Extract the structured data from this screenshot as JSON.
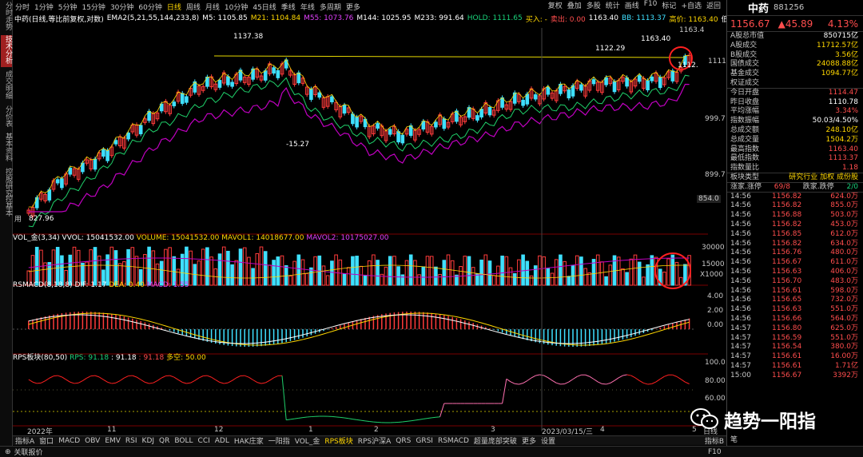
{
  "left_tabs": [
    "分时走势",
    "技术分析",
    "成交明细",
    "分价表",
    "基本资料",
    "控股研究",
    "控基本"
  ],
  "toolbar": {
    "periods": [
      "分时",
      "1分钟",
      "5分钟",
      "15分钟",
      "30分钟",
      "60分钟",
      "日线",
      "周线",
      "月线",
      "10分钟",
      "45日线",
      "季线",
      "年线",
      "多周期",
      "更多"
    ],
    "active_period": "日线",
    "right_items": [
      "复权",
      "叠加",
      "多股",
      "统计",
      "画线",
      "F10",
      "标记",
      "+自选",
      "返回"
    ]
  },
  "ema_bar": {
    "title": "中药(日线,等比前复权,对数)",
    "ema": "EMA2(5,21,55,144,233,8)",
    "m5": "M5: 1105.85",
    "m21": "M21: 1104.84",
    "m55": "M55: 1073.76",
    "m144": "M144: 1025.95",
    "m233": "M233: 991.64",
    "hold": "HOLD: 1111.65",
    "buy": "买入: -",
    "sell": "卖出: 0.00",
    "m_last": "1163.40",
    "bb": "BB: 1113.37",
    "high": "高价: 1163.40",
    "close_mark": "低"
  },
  "price_axis": [
    "1163.4",
    "1111",
    "999.7",
    "899.7",
    "854.0"
  ],
  "annotations": {
    "high1": "1137.38",
    "high2": "1122.29",
    "high3": "1163.40",
    "low1": "-15.27",
    "low2": "827.96",
    "last_price": "1112.",
    "bottom_tag": "用"
  },
  "vol_panel": {
    "label": "VOL_金(3,34)",
    "vvol": "VVOL: 15041532.00",
    "volume": "VOLUME: 15041532.00",
    "mavol1": "MAVOL1: 14018677.00",
    "mavol2": "MAVOL2: 10175027.00",
    "axis": [
      "30000",
      "15000",
      "X1000"
    ]
  },
  "macd_panel": {
    "label": "RSMACD(8,18,8)",
    "dif": "DIF: 1.17",
    "dea": "DEA: 0.40",
    "macd": "MACD: 1.55",
    "axis": [
      "4.00",
      "2.00",
      "0.00"
    ]
  },
  "rps_panel": {
    "label": "RPS板块(80,50)",
    "rps": "RPS: 91.18",
    "v2": ": 91.18",
    "v3": ": 91.18",
    "duokong": "多空: 50.00",
    "axis": [
      "100.0",
      "80.00",
      "60.00"
    ]
  },
  "x_axis": [
    "2022年",
    "11",
    "12",
    "1",
    "2",
    "3",
    "2023/03/15/三",
    "4",
    "5"
  ],
  "x_right": "日线",
  "bottom_tabs": [
    "指标A",
    "窗口",
    "MACD",
    "OBV",
    "EMV",
    "RSI",
    "KDJ",
    "QR",
    "BOLL",
    "CCI",
    "ADL",
    "HAK庄家",
    "一阳指",
    "VOL_金",
    "RPS板块",
    "RPS沪深A",
    "QRS",
    "GRSI",
    "RSMACD",
    "超量庞部突破",
    "更多",
    "设置"
  ],
  "bottom_active": "RPS板块",
  "bottom_right": "指标B",
  "status": {
    "left": "关联报价",
    "right": "F10"
  },
  "right_panel": {
    "name": "中药",
    "code": "881256",
    "price": "1156.67",
    "change": "▲45.89",
    "pct": "4.13%",
    "stats": [
      {
        "k": "A股总市值",
        "v": "850715亿",
        "c": "white"
      },
      {
        "k": "A股成交",
        "v": "11712.57亿",
        "c": "yellow"
      },
      {
        "k": "B股成交",
        "v": "3.56亿",
        "c": "yellow"
      },
      {
        "k": "国债成交",
        "v": "24088.88亿",
        "c": "yellow"
      },
      {
        "k": "基金成交",
        "v": "1094.77亿",
        "c": "yellow"
      },
      {
        "k": "权证成交",
        "v": "",
        "c": "yellow"
      },
      {
        "k": "今日开盘",
        "v": "1114.47",
        "c": "red"
      },
      {
        "k": "昨日收盘",
        "v": "1110.78",
        "c": "white"
      },
      {
        "k": "平均涨幅",
        "v": "3.34%",
        "c": "red"
      },
      {
        "k": "指数振幅",
        "v": "50.03/4.50%",
        "c": "white"
      },
      {
        "k": "总成交额",
        "v": "248.10亿",
        "c": "yellow"
      },
      {
        "k": "总成交量",
        "v": "1504.2万",
        "c": "yellow"
      },
      {
        "k": "最高指数",
        "v": "1163.40",
        "c": "red"
      },
      {
        "k": "最低指数",
        "v": "1113.37",
        "c": "red"
      },
      {
        "k": "指数量比",
        "v": "1.18",
        "c": "red"
      }
    ],
    "board_type": {
      "k": "板块类型",
      "v": "研究行业 加权 成份股"
    },
    "rise_fall": {
      "k1": "涨家.涨停",
      "v1": "69/8",
      "k2": "跌家.跌停",
      "v2": "2/0"
    },
    "ticks": [
      [
        "14:56",
        "1156.82",
        "624.0万"
      ],
      [
        "14:56",
        "1156.82",
        "855.0万"
      ],
      [
        "14:56",
        "1156.88",
        "503.0万"
      ],
      [
        "14:56",
        "1156.82",
        "453.0万"
      ],
      [
        "14:56",
        "1156.85",
        "612.0万"
      ],
      [
        "14:56",
        "1156.82",
        "634.0万"
      ],
      [
        "14:56",
        "1156.76",
        "480.0万"
      ],
      [
        "14:56",
        "1156.67",
        "611.0万"
      ],
      [
        "14:56",
        "1156.63",
        "406.0万"
      ],
      [
        "14:56",
        "1156.70",
        "483.0万"
      ],
      [
        "14:56",
        "1156.61",
        "598.0万"
      ],
      [
        "14:56",
        "1156.65",
        "732.0万"
      ],
      [
        "14:56",
        "1156.63",
        "551.0万"
      ],
      [
        "14:56",
        "1156.66",
        "564.0万"
      ],
      [
        "14:57",
        "1156.80",
        "625.0万"
      ],
      [
        "14:57",
        "1156.59",
        "551.0万"
      ],
      [
        "14:57",
        "1156.54",
        "380.0万"
      ],
      [
        "14:57",
        "1156.61",
        "16.00万"
      ],
      [
        "14:57",
        "1156.61",
        "1.71亿"
      ],
      [
        "15:00",
        "1156.67",
        "3392万"
      ]
    ],
    "footer": "笔"
  },
  "watermark": "趋势一阳指"
}
